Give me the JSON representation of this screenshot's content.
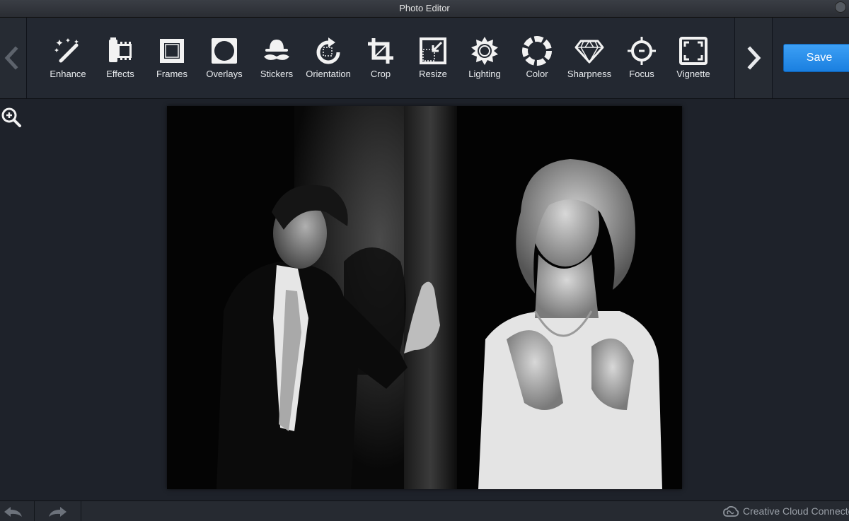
{
  "window": {
    "title": "Photo Editor"
  },
  "toolbar": {
    "tools": [
      {
        "label": "Enhance",
        "icon": "magic-wand-icon"
      },
      {
        "label": "Effects",
        "icon": "film-icon"
      },
      {
        "label": "Frames",
        "icon": "frame-icon"
      },
      {
        "label": "Overlays",
        "icon": "overlay-icon"
      },
      {
        "label": "Stickers",
        "icon": "mustache-hat-icon"
      },
      {
        "label": "Orientation",
        "icon": "rotate-icon"
      },
      {
        "label": "Crop",
        "icon": "crop-icon"
      },
      {
        "label": "Resize",
        "icon": "resize-icon"
      },
      {
        "label": "Lighting",
        "icon": "sun-icon"
      },
      {
        "label": "Color",
        "icon": "color-wheel-icon"
      },
      {
        "label": "Sharpness",
        "icon": "diamond-icon"
      },
      {
        "label": "Focus",
        "icon": "target-icon"
      },
      {
        "label": "Vignette",
        "icon": "vignette-icon"
      }
    ],
    "save_label": "Save"
  },
  "status": {
    "cc_label": "Creative Cloud Connected"
  },
  "colors": {
    "accent": "#1f88ea",
    "background": "#1e222a",
    "toolbar": "#232831"
  }
}
